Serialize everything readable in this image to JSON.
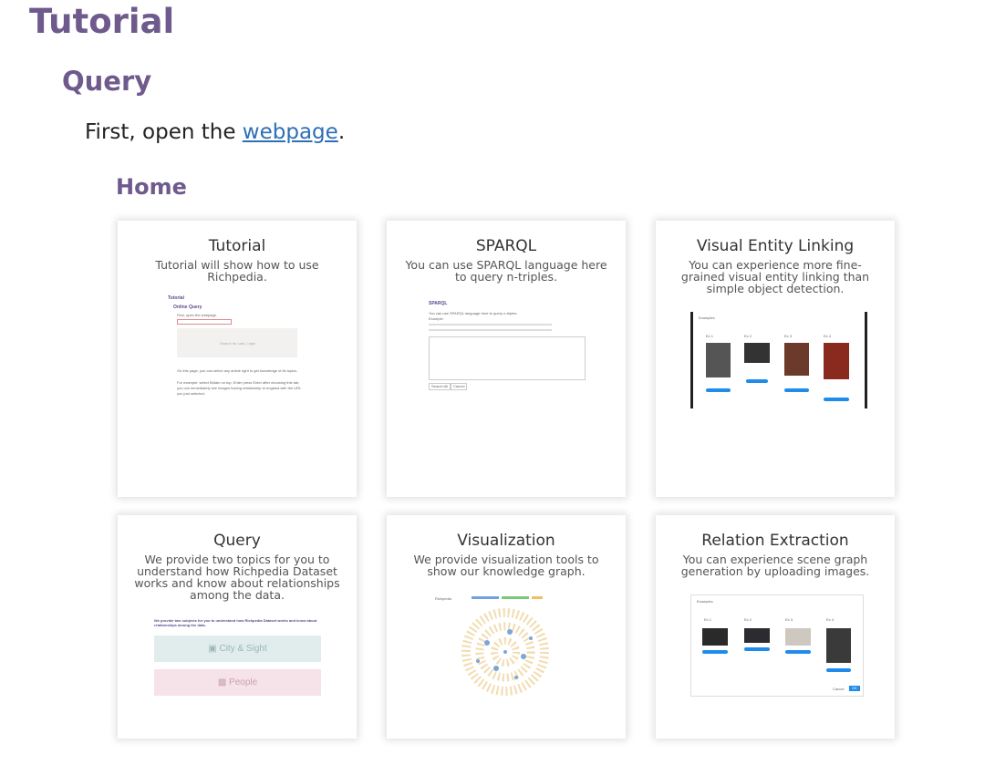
{
  "doc": {
    "title": "Tutorial",
    "section": "Query",
    "intro_before": "First, open the ",
    "intro_link": "webpage",
    "intro_after": ".",
    "subsection": "Home"
  },
  "cards": [
    {
      "title": "Tutorial",
      "desc": "Tutorial will show how to use Richpedia."
    },
    {
      "title": "SPARQL",
      "desc": "You can use SPARQL language here to query n-triples."
    },
    {
      "title": "Visual Entity Linking",
      "desc": "You can experience more fine-grained visual entity linking than simple object detection."
    },
    {
      "title": "Query",
      "desc": "We provide two topics for you to understand how Richpedia Dataset works and know about relationships among the data."
    },
    {
      "title": "Visualization",
      "desc": "We provide visualization tools to show our knowledge graph."
    },
    {
      "title": "Relation Extraction",
      "desc": "You can experience scene graph generation by uploading images."
    }
  ],
  "thumbs": {
    "tutorial": {
      "heading": "Tutorial",
      "subheading": "Online Query",
      "line1": "First, open the webpage.",
      "box": "Search for Last, Login",
      "note1": "On this page, you can select any article right to get knowledge of its topics.",
      "note2": "For example: select Britain on top, Enter press Enter after choosing this tab, you can immediately see images having relationship to england with the URL you just selected."
    },
    "sparql": {
      "heading": "SPARQL",
      "line1": "You can use SPARQL language here to query n-triples.",
      "line2": "Example:",
      "btn1": "Search All",
      "btn2": "Cancel"
    },
    "vel": {
      "header": "Examples",
      "labels": [
        "Ex 1",
        "Ex 2",
        "Ex 3",
        "Ex 4"
      ]
    },
    "query": {
      "line": "We provide two subjects for you to understand how Richpedia Dataset works and know about relationships among the data.",
      "city": "City & Sight",
      "people": "People"
    },
    "viz": {
      "brand": "Richpedia"
    },
    "rel": {
      "header": "Examples",
      "labels": [
        "Ex 1",
        "Ex 2",
        "Ex 3",
        "Ex 4"
      ],
      "cancel": "Cancel",
      "ok": "OK"
    }
  },
  "colors": {
    "heading": "#6e5a8c",
    "link": "#2e6fb5",
    "button_blue": "#1f8ceb"
  }
}
